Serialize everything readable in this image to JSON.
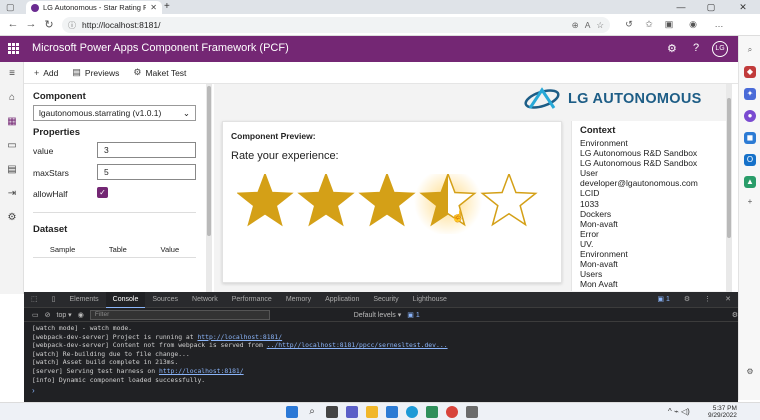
{
  "browser": {
    "tab_title": "LG Autonomous - Star Rating P",
    "url": "http://localhost:8181/"
  },
  "app": {
    "title": "Microsoft Power Apps Component Framework (PCF)",
    "user_initials": "LG"
  },
  "commands": [
    {
      "label": "Add",
      "icon": "plus-icon"
    },
    {
      "label": "Previews",
      "icon": "preview-icon"
    },
    {
      "label": "Maket Test",
      "icon": "gear-icon"
    }
  ],
  "props": {
    "component_heading": "Component",
    "component_value": "lgautonomous.starrating (v1.0.1)",
    "properties_heading": "Properties",
    "value_label": "value",
    "value": "3",
    "maxstars_label": "maxStars",
    "maxstars": "5",
    "allowhalf_label": "allowHalf",
    "allowhalf_checked": true,
    "dataset_heading": "Dataset",
    "dataset_columns": [
      "Sample",
      "Table",
      "Value"
    ]
  },
  "preview": {
    "logo_text": "LG AUTONOMOUS",
    "card_title": "Component Preview:",
    "rate_label": "Rate your experience:",
    "rating": {
      "filled": 3,
      "half": 1,
      "max": 5,
      "color": "#d4a017"
    }
  },
  "context": {
    "title": "Context",
    "lines": [
      "Environment",
      "LG Autonomous R&D Sandbox",
      "LG Autonomous R&D Sandbox",
      "User",
      "developer@lgautonomous.com",
      "LCID",
      "1033",
      "Dockers",
      "Mon-avaft",
      "Error",
      "UV.",
      "Environment",
      "Mon-avaft",
      "Users",
      "Mon Avaft"
    ]
  },
  "devtools": {
    "tabs": [
      "Elements",
      "Console",
      "Sources",
      "Network",
      "Performance",
      "Memory",
      "Application",
      "Security",
      "Lighthouse"
    ],
    "active_tab": "Console",
    "context": "top",
    "filter_placeholder": "Filter",
    "levels": "Default levels",
    "issues_count": "1",
    "logs": [
      {
        "text": "[watch mode] - watch mode.",
        "link": ""
      },
      {
        "text": "[webpack-dev-server] Project is running at ",
        "link": "http://localhost:8181/"
      },
      {
        "text": "[webpack-dev-server] Content not from webpack is served from ",
        "link": "../http//localhost:8181/ppcc/sernesltest.dev..."
      },
      {
        "text": "[watch] Re-building due to file change...",
        "link": ""
      },
      {
        "text": "[watch] Asset build complete in 213ms.",
        "link": ""
      },
      {
        "text": "[server] Serving test harness on ",
        "link": "http://localhost:8181/"
      },
      {
        "text": "[info] Dynamic component loaded successfully.",
        "link": ""
      }
    ]
  },
  "taskbar": {
    "time": "5:37 PM",
    "date": "9/29/2022"
  },
  "colors": {
    "brand": "#742774",
    "star": "#d4a017"
  }
}
